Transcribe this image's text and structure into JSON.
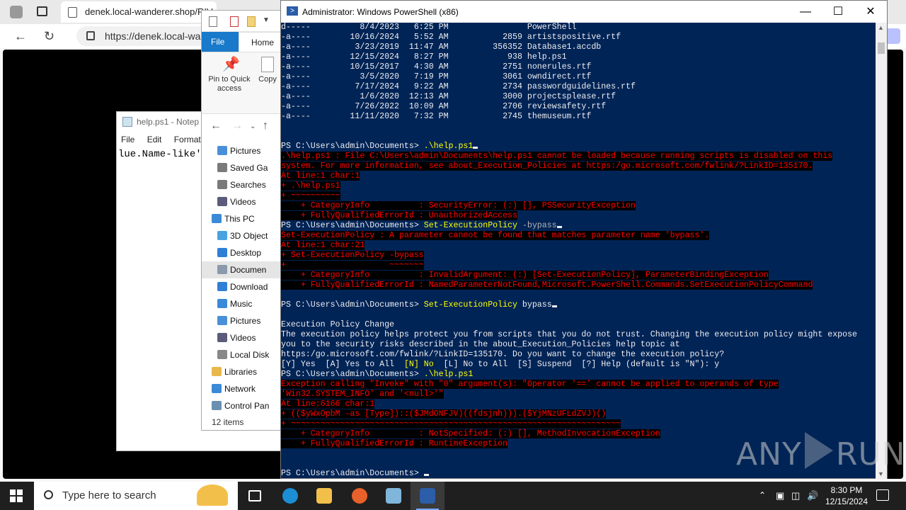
{
  "browser": {
    "tab_title": "denek.local-wanderer.shop/RIV",
    "url": "https://denek.local-wa"
  },
  "notepad": {
    "title": "help.ps1 - Notep",
    "menu": [
      "File",
      "Edit",
      "Format"
    ],
    "content": "lue.Name-like'*"
  },
  "explorer": {
    "ribbon_tabs": [
      "File",
      "Home"
    ],
    "ribbon_buttons": [
      "Pin to Quick access",
      "Copy"
    ],
    "tree": [
      {
        "label": "Pictures",
        "icon": "pictures-icon",
        "indent": 1,
        "color": "#4a90d9"
      },
      {
        "label": "Saved Ga",
        "icon": "saved-games-icon",
        "indent": 1,
        "color": "#7a7a7a"
      },
      {
        "label": "Searches",
        "icon": "searches-icon",
        "indent": 1,
        "color": "#7a7a7a"
      },
      {
        "label": "Videos",
        "icon": "videos-icon",
        "indent": 1,
        "color": "#5b5b7a"
      },
      {
        "label": "This PC",
        "icon": "this-pc-icon",
        "indent": 0,
        "color": "#3a8ad8"
      },
      {
        "label": "3D Object",
        "icon": "3d-objects-icon",
        "indent": 1,
        "color": "#4aa3e0"
      },
      {
        "label": "Desktop",
        "icon": "desktop-icon",
        "indent": 1,
        "color": "#2f7fd6"
      },
      {
        "label": "Documen",
        "icon": "documents-icon",
        "indent": 1,
        "color": "#8a9aaa",
        "selected": true
      },
      {
        "label": "Download",
        "icon": "downloads-icon",
        "indent": 1,
        "color": "#2f7fd6"
      },
      {
        "label": "Music",
        "icon": "music-icon",
        "indent": 1,
        "color": "#3a8ad8"
      },
      {
        "label": "Pictures",
        "icon": "pictures-icon",
        "indent": 1,
        "color": "#4a90d9"
      },
      {
        "label": "Videos",
        "icon": "videos-icon",
        "indent": 1,
        "color": "#5b5b7a"
      },
      {
        "label": "Local Disk",
        "icon": "local-disk-icon",
        "indent": 1,
        "color": "#888888"
      },
      {
        "label": "Libraries",
        "icon": "libraries-icon",
        "indent": 0,
        "color": "#e8b84a"
      },
      {
        "label": "Network",
        "icon": "network-icon",
        "indent": 0,
        "color": "#3a8ad8"
      },
      {
        "label": "Control Pan",
        "icon": "control-panel-icon",
        "indent": 0,
        "color": "#6a8fb0"
      }
    ],
    "status": "12 items"
  },
  "powershell": {
    "title": "Administrator: Windows PowerShell (x86)",
    "lines": [
      {
        "t": "d-----          8/4/2023   6:25 PM                PowerShell",
        "c": ""
      },
      {
        "t": "-a----        10/16/2024   5:52 AM           2859 artistspositive.rtf",
        "c": ""
      },
      {
        "t": "-a----         3/23/2019  11:47 AM         356352 Database1.accdb",
        "c": ""
      },
      {
        "t": "-a----        12/15/2024   8:27 PM            938 help.ps1",
        "c": ""
      },
      {
        "t": "-a----        10/15/2017   4:30 AM           2751 nonerules.rtf",
        "c": ""
      },
      {
        "t": "-a----          3/5/2020   7:19 PM           3061 owndirect.rtf",
        "c": ""
      },
      {
        "t": "-a----         7/17/2024   9:22 AM           2734 passwordguidelines.rtf",
        "c": ""
      },
      {
        "t": "-a----          1/6/2020  12:13 AM           3000 projectsplease.rtf",
        "c": ""
      },
      {
        "t": "-a----         7/26/2022  10:09 AM           2706 reviewsafety.rtf",
        "c": ""
      },
      {
        "t": "-a----        11/11/2020   7:32 PM           2745 themuseum.rtf",
        "c": ""
      },
      {
        "t": "",
        "c": ""
      },
      {
        "t": "",
        "c": ""
      },
      {
        "t": "PS C:\\Users\\admin\\Documents> ",
        "c": "",
        "cmd": ".\\help.ps1",
        "cursor": true
      },
      {
        "t": ".\\help.ps1 : File C:\\Users\\admin\\Documents\\help.ps1 cannot be loaded because running scripts is disabled on this",
        "c": "err"
      },
      {
        "t": "system. For more information, see about_Execution_Policies at https:/go.microsoft.com/fwlink/?LinkID=135170.",
        "c": "err"
      },
      {
        "t": "At line:1 char:1",
        "c": "err"
      },
      {
        "t": "+ .\\help.ps1",
        "c": "err"
      },
      {
        "t": "+ ~~~~~~~~~~",
        "c": "err"
      },
      {
        "t": "    + CategoryInfo          : SecurityError: (:) [], PSSecurityException",
        "c": "err"
      },
      {
        "t": "    + FullyQualifiedErrorId : UnauthorizedAccess",
        "c": "err"
      },
      {
        "t": "PS C:\\Users\\admin\\Documents> ",
        "c": "",
        "cmd": "Set-ExecutionPolicy",
        "arg": " -bypass",
        "cursor": true
      },
      {
        "t": "Set-ExecutionPolicy : A parameter cannot be found that matches parameter name 'bypass'.",
        "c": "err"
      },
      {
        "t": "At line:1 char:21",
        "c": "err"
      },
      {
        "t": "+ Set-ExecutionPolicy -bypass",
        "c": "err"
      },
      {
        "t": "+                     ~~~~~~~",
        "c": "err"
      },
      {
        "t": "    + CategoryInfo          : InvalidArgument: (:) [Set-ExecutionPolicy], ParameterBindingException",
        "c": "err"
      },
      {
        "t": "    + FullyQualifiedErrorId : NamedParameterNotFound,Microsoft.PowerShell.Commands.SetExecutionPolicyCommand",
        "c": "err"
      },
      {
        "t": "",
        "c": ""
      },
      {
        "t": "PS C:\\Users\\admin\\Documents> ",
        "c": "",
        "cmd": "Set-ExecutionPolicy",
        "arg2": " bypass",
        "cursor": true
      },
      {
        "t": "",
        "c": ""
      },
      {
        "t": "Execution Policy Change",
        "c": ""
      },
      {
        "t": "The execution policy helps protect you from scripts that you do not trust. Changing the execution policy might expose",
        "c": ""
      },
      {
        "t": "you to the security risks described in the about_Execution_Policies help topic at",
        "c": ""
      },
      {
        "t": "https:/go.microsoft.com/fwlink/?LinkID=135170. Do you want to change the execution policy?",
        "c": ""
      },
      {
        "t": "[Y] Yes  [A] Yes to All  ",
        "c": "",
        "hl": "[N] No",
        "rest": "  [L] No to All  [S] Suspend  [?] Help (default is \"N\"): y"
      },
      {
        "t": "PS C:\\Users\\admin\\Documents> ",
        "c": "",
        "cmd": ".\\help.ps1"
      },
      {
        "t": "Exception calling \"Invoke\" with \"0\" argument(s): \"Operator '==' cannot be applied to operands of type",
        "c": "err"
      },
      {
        "t": "'Win32.SYSTEM_INFO' and '<null>'\"",
        "c": "err"
      },
      {
        "t": "At line:6166 char:1",
        "c": "err"
      },
      {
        "t": "+ (($yWxOpbM -as [Type])::($JMdONFJV)((fdsjnh))).($YjMNzUFLdZVJ)()",
        "c": "err"
      },
      {
        "t": "+ ~~~~~~~~~~~~~~~~~~~~~~~~~~~~~~~~~~~~~~~~~~~~~~~~~~~~~~~~~~~~~~~~~~~",
        "c": "err"
      },
      {
        "t": "    + CategoryInfo          : NotSpecified: (:) [], MethodInvocationException",
        "c": "err"
      },
      {
        "t": "    + FullyQualifiedErrorId : RuntimeException",
        "c": "err"
      },
      {
        "t": "",
        "c": ""
      },
      {
        "t": "",
        "c": ""
      },
      {
        "t": "PS C:\\Users\\admin\\Documents> ",
        "c": "",
        "cursor": true
      }
    ]
  },
  "watermark": {
    "left": "ANY",
    "right": "RUN"
  },
  "taskbar": {
    "search_placeholder": "Type here to search",
    "apps": [
      {
        "name": "task-view-icon",
        "color": "#1f1f1f"
      },
      {
        "name": "edge-icon",
        "color": "#1b8ed4"
      },
      {
        "name": "file-explorer-icon",
        "color": "#f2c04a"
      },
      {
        "name": "firefox-icon",
        "color": "#e8602a"
      },
      {
        "name": "notepad-icon",
        "color": "#7fb6d9"
      },
      {
        "name": "powershell-icon",
        "color": "#2b5da8",
        "active": true
      }
    ],
    "time": "8:30 PM",
    "date": "12/15/2024"
  },
  "colors": {
    "ps_bg": "#012456",
    "ps_error": "#ff0000",
    "ps_command": "#ffff00"
  }
}
